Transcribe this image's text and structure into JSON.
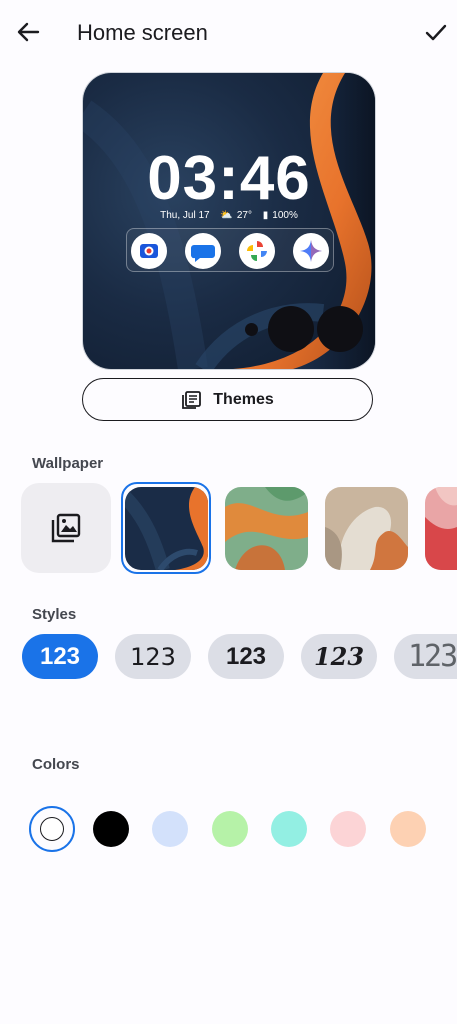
{
  "header": {
    "title": "Home screen",
    "back_icon": "arrow-back-icon",
    "confirm_icon": "check-icon"
  },
  "preview": {
    "time": "03:46",
    "date": "Thu, Jul 17",
    "weather": "27°",
    "battery": "100%",
    "apps": [
      "camera-icon",
      "messages-icon",
      "photos-icon",
      "gemini-icon"
    ]
  },
  "themes_button": {
    "label": "Themes",
    "icon": "themes-icon"
  },
  "wallpaper": {
    "label": "Wallpaper",
    "picker_icon": "gallery-icon",
    "thumbnails": [
      "blue-orange-curve",
      "green-orange-ribbon",
      "beige-sculpture",
      "pink-red-abstract"
    ],
    "selected_index": 0
  },
  "styles": {
    "label": "Styles",
    "options": [
      "123",
      "123",
      "123",
      "123",
      "123"
    ],
    "selected_index": 0
  },
  "colors": {
    "label": "Colors",
    "swatches": [
      "#ffffff",
      "#000000",
      "#d3e1fb",
      "#b6f2a8",
      "#93efe3",
      "#fcd4d6",
      "#fdd1b3"
    ],
    "selected_index": 0
  },
  "accent": "#1a73e8"
}
